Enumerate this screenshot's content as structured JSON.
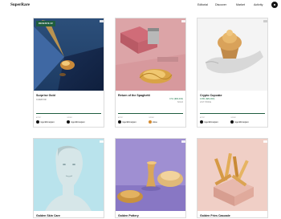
{
  "header": {
    "logo": "SuperRare",
    "nav": [
      "Editorial",
      "Discover",
      "Market",
      "Activity"
    ]
  },
  "colors": {
    "accent_green": "#1f5d3f",
    "price_green": "#1f7a4d",
    "text": "#111111"
  },
  "cards": [
    {
      "title": "Surprise Gold",
      "badge": "RESERVE #2",
      "subline": "CURATOR",
      "price": "",
      "price_note": "",
      "artist_label": "ARTIST",
      "artist": "rogerkilimanjaro",
      "owner_label": "OWNER",
      "owner": "rogerkilimanjaro"
    },
    {
      "title": "Return of the Spaghetti",
      "badge": "",
      "subline": "",
      "price": "0.51 ($84,000)",
      "price_note": "SOLD",
      "artist_label": "ARTIST",
      "artist": "rogerkilimanjaro",
      "owner_label": "OWNER",
      "owner": "sikoe"
    },
    {
      "title": "Crypto Cupcake",
      "badge": "",
      "subline": "",
      "price": "0.051 ($84,000)",
      "price_note": "LIST PRICE",
      "artist_label": "ARTIST",
      "artist": "rogerkilimanjaro",
      "owner_label": "OWNER",
      "owner": "rogerkilimanjaro"
    },
    {
      "title": "Golden Skin Care"
    },
    {
      "title": "Golden Pottery"
    },
    {
      "title": "Golden Fries Cascade"
    }
  ]
}
